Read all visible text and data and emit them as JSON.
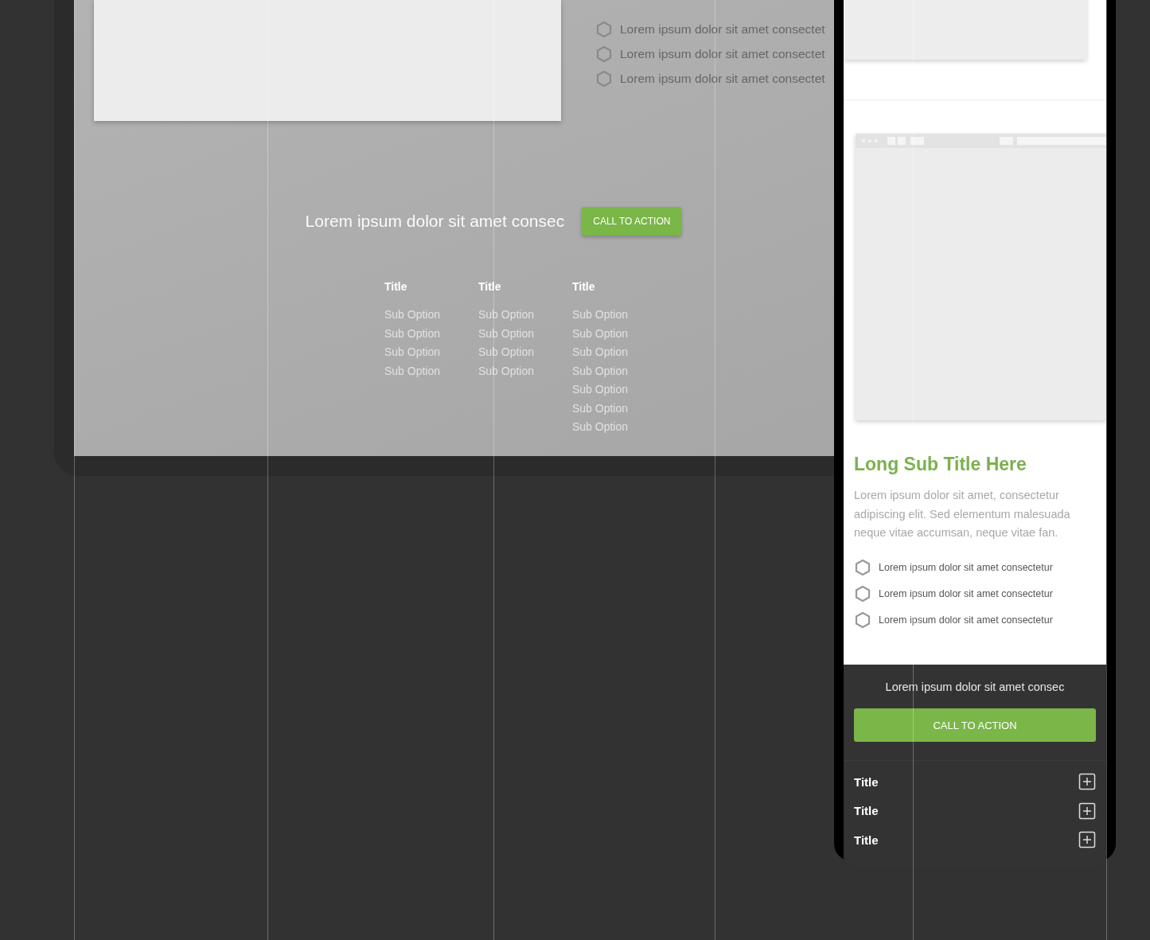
{
  "tablet": {
    "checklist": [
      "Lorem ipsum dolor sit amet consectet",
      "Lorem ipsum dolor sit amet consectet",
      "Lorem ipsum dolor sit amet consectet"
    ],
    "cta": {
      "text": "Lorem ipsum dolor sit amet consec",
      "button": "CALL TO ACTION"
    },
    "footer_columns": [
      {
        "title": "Title",
        "options": [
          "Sub Option",
          "Sub Option",
          "Sub Option",
          "Sub Option"
        ]
      },
      {
        "title": "Title",
        "options": [
          "Sub Option",
          "Sub Option",
          "Sub Option",
          "Sub Option"
        ]
      },
      {
        "title": "Title",
        "options": [
          "Sub Option",
          "Sub Option",
          "Sub Option",
          "Sub Option",
          "Sub Option",
          "Sub Option",
          "Sub Option"
        ]
      }
    ]
  },
  "phone": {
    "subtitle": "Long Sub Title Here",
    "paragraph": "Lorem ipsum dolor sit amet, consectetur adipiscing elit. Sed elementum malesuada neque vitae accumsan, neque vitae fan.",
    "checklist": [
      "Lorem ipsum dolor sit amet consectetur",
      "Lorem ipsum dolor sit amet consectetur",
      "Lorem ipsum dolor sit amet consectetur"
    ],
    "cta": {
      "text": "Lorem ipsum dolor sit amet consec",
      "button": "CALL TO ACTION"
    },
    "accordion": [
      {
        "title": "Title",
        "expanded": false
      },
      {
        "title": "Title",
        "expanded": false
      },
      {
        "title": "Title",
        "expanded": false
      }
    ]
  }
}
